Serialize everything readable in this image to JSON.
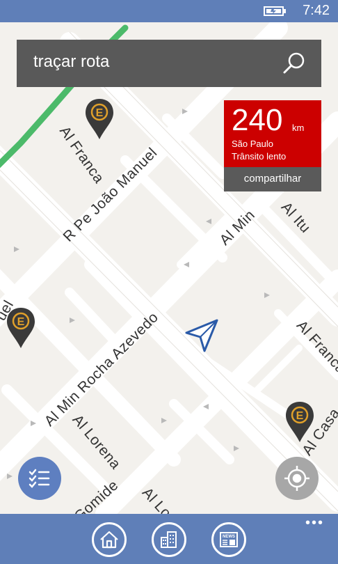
{
  "status_bar": {
    "time": "7:42",
    "battery_icon": "battery-charging-icon"
  },
  "search": {
    "text": "traçar rota",
    "icon": "search-icon"
  },
  "traffic_card": {
    "distance": "240",
    "unit": "km",
    "city": "São Paulo",
    "status": "Trânsito lento",
    "share_label": "compartilhar",
    "color": "#cc0000"
  },
  "map": {
    "streets": [
      {
        "name": "Al Franca"
      },
      {
        "name": "R Pe João Manuel"
      },
      {
        "name": "Al Min Rocha Azevedo"
      },
      {
        "name": "Al Lorena"
      },
      {
        "name": "Al Lorena"
      },
      {
        "name": "Al Itu"
      },
      {
        "name": "Al Min"
      },
      {
        "name": "Al Franca"
      },
      {
        "name": "Al Casa"
      },
      {
        "name": "to Gomide"
      },
      {
        "name": "uel"
      }
    ],
    "pins": [
      {
        "label": "E"
      },
      {
        "label": "E"
      },
      {
        "label": "E"
      }
    ],
    "route_color": "#4cba6a",
    "pin_color": "#3a3a3a",
    "pin_accent": "#e0a02a"
  },
  "controls": {
    "list_icon": "checklist-icon",
    "locate_icon": "locate-icon"
  },
  "app_bar": {
    "buttons": [
      {
        "icon": "home-icon"
      },
      {
        "icon": "buildings-icon"
      },
      {
        "icon": "news-icon",
        "text": "NEWS"
      }
    ],
    "more": "•••"
  }
}
